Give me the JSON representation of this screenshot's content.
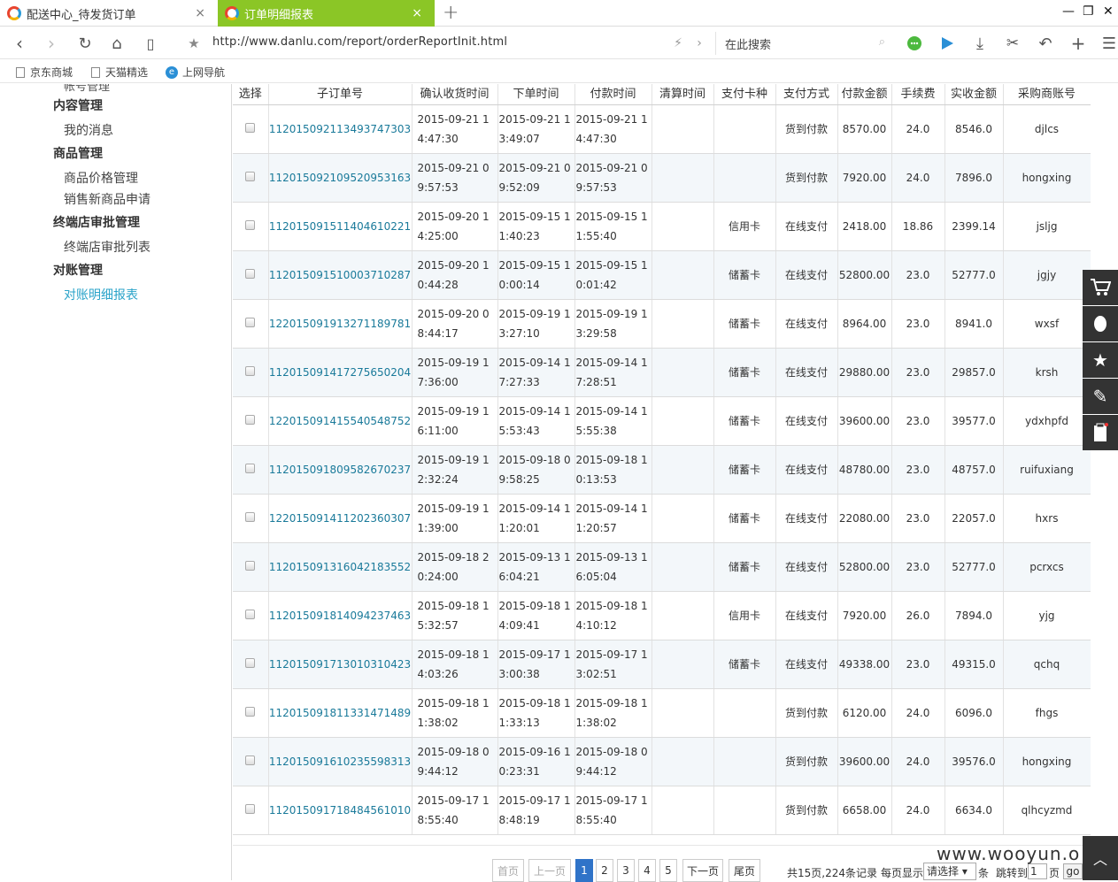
{
  "tabs": [
    {
      "title": "配送中心_待发货订单",
      "close": "×"
    },
    {
      "title": "订单明细报表",
      "close": "×"
    }
  ],
  "new_tab": "+",
  "window_controls": {
    "minimize": "—",
    "restore": "❐",
    "close": "✕"
  },
  "toolbar": {
    "url": "http://www.danlu.com/report/orderReportInit.html",
    "search_placeholder": "在此搜索"
  },
  "bookmarks": [
    "京东商城",
    "天猫精选",
    "上网导航"
  ],
  "sidebar": {
    "cut_item": "帐号管理",
    "groups": [
      {
        "head": "内容管理",
        "items": [
          "我的消息"
        ]
      },
      {
        "head": "商品管理",
        "items": [
          "商品价格管理",
          "销售新商品申请"
        ]
      },
      {
        "head": "终端店审批管理",
        "items": [
          "终端店审批列表"
        ]
      },
      {
        "head": "对账管理",
        "items": [
          "对账明细报表"
        ]
      }
    ],
    "active_item": "对账明细报表"
  },
  "table": {
    "columns": [
      "选择",
      "子订单号",
      "确认收货时间",
      "下单时间",
      "付款时间",
      "清算时间",
      "支付卡种",
      "支付方式",
      "付款金额",
      "手续费",
      "实收金额",
      "采购商账号"
    ],
    "rows": [
      [
        "112015092113493747303",
        "2015-09-21 14:47:30",
        "2015-09-21 13:49:07",
        "2015-09-21 14:47:30",
        "",
        "",
        "货到付款",
        "8570.00",
        "24.0",
        "8546.0",
        "djlcs"
      ],
      [
        "112015092109520953163",
        "2015-09-21 09:57:53",
        "2015-09-21 09:52:09",
        "2015-09-21 09:57:53",
        "",
        "",
        "货到付款",
        "7920.00",
        "24.0",
        "7896.0",
        "hongxing"
      ],
      [
        "112015091511404610221",
        "2015-09-20 14:25:00",
        "2015-09-15 11:40:23",
        "2015-09-15 11:55:40",
        "",
        "信用卡",
        "在线支付",
        "2418.00",
        "18.86",
        "2399.14",
        "jsljg"
      ],
      [
        "112015091510003710287",
        "2015-09-20 10:44:28",
        "2015-09-15 10:00:14",
        "2015-09-15 10:01:42",
        "",
        "储蓄卡",
        "在线支付",
        "52800.00",
        "23.0",
        "52777.0",
        "jgjy"
      ],
      [
        "122015091913271189781",
        "2015-09-20 08:44:17",
        "2015-09-19 13:27:10",
        "2015-09-19 13:29:58",
        "",
        "储蓄卡",
        "在线支付",
        "8964.00",
        "23.0",
        "8941.0",
        "wxsf"
      ],
      [
        "112015091417275650204",
        "2015-09-19 17:36:00",
        "2015-09-14 17:27:33",
        "2015-09-14 17:28:51",
        "",
        "储蓄卡",
        "在线支付",
        "29880.00",
        "23.0",
        "29857.0",
        "krsh"
      ],
      [
        "122015091415540548752",
        "2015-09-19 16:11:00",
        "2015-09-14 15:53:43",
        "2015-09-14 15:55:38",
        "",
        "储蓄卡",
        "在线支付",
        "39600.00",
        "23.0",
        "39577.0",
        "ydxhpfd"
      ],
      [
        "112015091809582670237",
        "2015-09-19 12:32:24",
        "2015-09-18 09:58:25",
        "2015-09-18 10:13:53",
        "",
        "储蓄卡",
        "在线支付",
        "48780.00",
        "23.0",
        "48757.0",
        "ruifuxiang"
      ],
      [
        "122015091411202360307",
        "2015-09-19 11:39:00",
        "2015-09-14 11:20:01",
        "2015-09-14 11:20:57",
        "",
        "储蓄卡",
        "在线支付",
        "22080.00",
        "23.0",
        "22057.0",
        "hxrs"
      ],
      [
        "112015091316042183552",
        "2015-09-18 20:24:00",
        "2015-09-13 16:04:21",
        "2015-09-13 16:05:04",
        "",
        "储蓄卡",
        "在线支付",
        "52800.00",
        "23.0",
        "52777.0",
        "pcrxcs"
      ],
      [
        "112015091814094237463",
        "2015-09-18 15:32:57",
        "2015-09-18 14:09:41",
        "2015-09-18 14:10:12",
        "",
        "信用卡",
        "在线支付",
        "7920.00",
        "26.0",
        "7894.0",
        "yjg"
      ],
      [
        "112015091713010310423",
        "2015-09-18 14:03:26",
        "2015-09-17 13:00:38",
        "2015-09-17 13:02:51",
        "",
        "储蓄卡",
        "在线支付",
        "49338.00",
        "23.0",
        "49315.0",
        "qchq"
      ],
      [
        "112015091811331471489",
        "2015-09-18 11:38:02",
        "2015-09-18 11:33:13",
        "2015-09-18 11:38:02",
        "",
        "",
        "货到付款",
        "6120.00",
        "24.0",
        "6096.0",
        "fhgs"
      ],
      [
        "112015091610235598313",
        "2015-09-18 09:44:12",
        "2015-09-16 10:23:31",
        "2015-09-18 09:44:12",
        "",
        "",
        "货到付款",
        "39600.00",
        "24.0",
        "39576.0",
        "hongxing"
      ],
      [
        "112015091718484561010",
        "2015-09-17 18:55:40",
        "2015-09-17 18:48:19",
        "2015-09-17 18:55:40",
        "",
        "",
        "货到付款",
        "6658.00",
        "24.0",
        "6634.0",
        "qlhcyzmd"
      ]
    ]
  },
  "pagination": {
    "first": "首页",
    "prev": "上一页",
    "pages": [
      "1",
      "2",
      "3",
      "4",
      "5"
    ],
    "current": "1",
    "next": "下一页",
    "last": "尾页",
    "summary": "共15页,224条记录",
    "per_page_label": "每页显示",
    "per_page_value": "请选择",
    "per_page_unit": "条",
    "jump_label": "跳转到",
    "jump_value": "1",
    "page_unit": "页",
    "go": "go"
  },
  "watermark": "www.wooyun.o"
}
